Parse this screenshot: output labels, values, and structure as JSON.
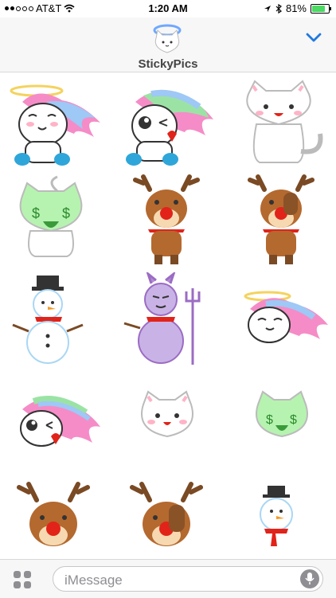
{
  "status_bar": {
    "carrier": "AT&T",
    "time": "1:20 AM",
    "battery_percent": "81%",
    "battery_level": 0.81,
    "signal_bars_filled": 2,
    "signal_bars_total": 5
  },
  "header": {
    "app_title": "StickyPics",
    "app_icon": "kitty-halo-icon",
    "collapse_icon": "chevron-down-icon"
  },
  "stickers": [
    {
      "name": "angel-unicorn-sitting"
    },
    {
      "name": "unicorn-wink-heart"
    },
    {
      "name": "white-kitty-sitting"
    },
    {
      "name": "money-kitty"
    },
    {
      "name": "reindeer-standing"
    },
    {
      "name": "reindeer-facepalm"
    },
    {
      "name": "snowman-top-hat"
    },
    {
      "name": "devil-snowman"
    },
    {
      "name": "angel-unicorn-head"
    },
    {
      "name": "unicorn-wink-head"
    },
    {
      "name": "kitty-head"
    },
    {
      "name": "money-kitty-head"
    },
    {
      "name": "reindeer-head"
    },
    {
      "name": "reindeer-facepalm-head"
    },
    {
      "name": "snowman-head"
    }
  ],
  "composer": {
    "placeholder": "iMessage",
    "apps_icon": "apps-grid-icon",
    "mic_icon": "microphone-icon"
  },
  "colors": {
    "accent": "#1f7ae0",
    "battery_green": "#4cd964",
    "unicorn_pink": "#f58cc7",
    "reindeer_brown": "#b4692f",
    "nose_red": "#e2231a",
    "devil_purple": "#c9b3e6",
    "money_green": "#b6f3b0"
  }
}
